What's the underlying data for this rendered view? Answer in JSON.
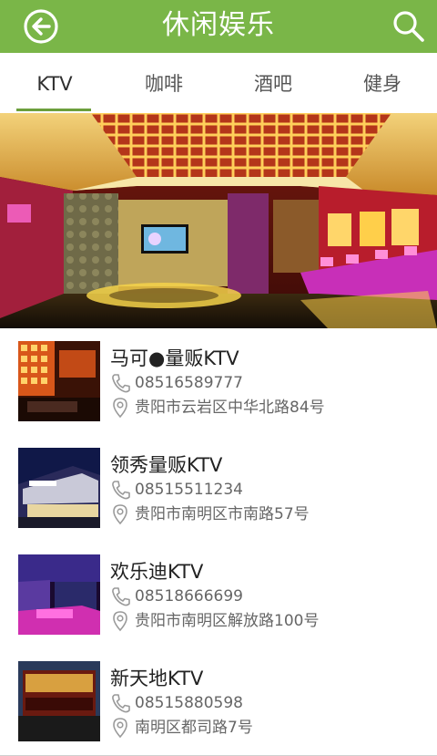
{
  "header": {
    "title": "休闲娱乐",
    "back_icon": "back-arrow-circle-icon",
    "search_icon": "search-icon",
    "color": "#7ab648"
  },
  "tabs": [
    {
      "label": "KTV",
      "active": true
    },
    {
      "label": "咖啡",
      "active": false
    },
    {
      "label": "酒吧",
      "active": false
    },
    {
      "label": "健身",
      "active": false
    }
  ],
  "venues": [
    {
      "name": "马可●量贩KTV",
      "phone": "08516589777",
      "address": "贵阳市云岩区中华北路84号"
    },
    {
      "name": "领秀量贩KTV",
      "phone": "08515511234",
      "address": "贵阳市南明区市南路57号"
    },
    {
      "name": "欢乐迪KTV",
      "phone": "08518666699",
      "address": "贵阳市南明区解放路100号"
    },
    {
      "name": "新天地KTV",
      "phone": "08515880598",
      "address": "南明区都司路7号"
    }
  ]
}
